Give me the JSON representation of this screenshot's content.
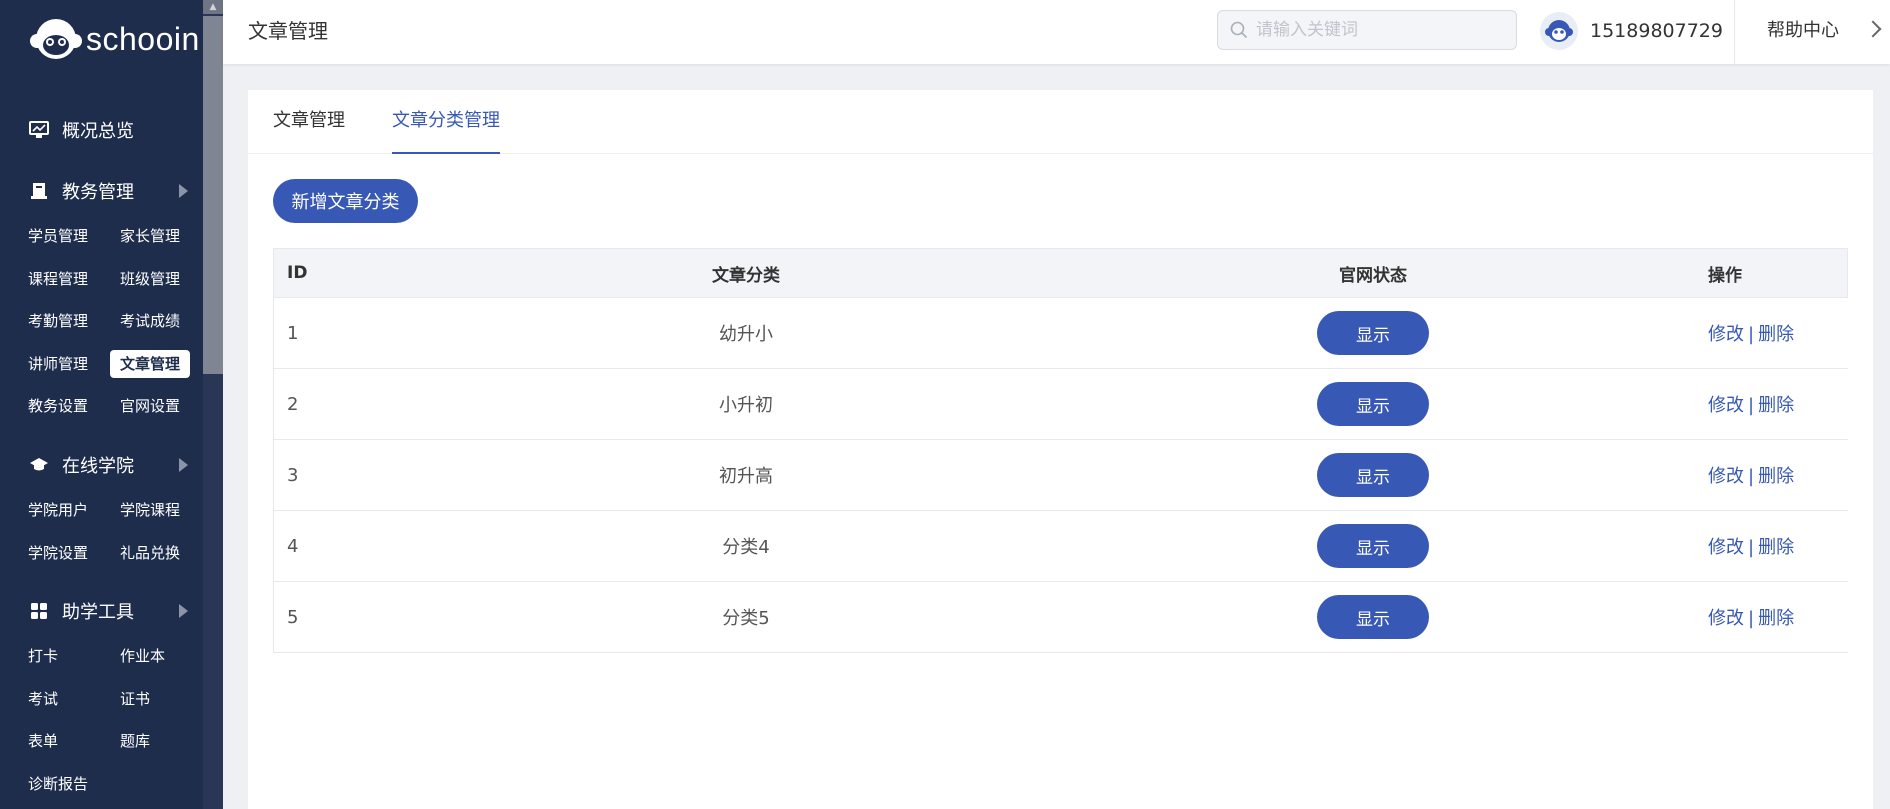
{
  "brand": {
    "name": "schooin"
  },
  "sidebar": {
    "groups": [
      {
        "label": "概况总览",
        "icon": "monitor-icon"
      },
      {
        "label": "教务管理",
        "icon": "book-icon",
        "items": [
          "学员管理",
          "家长管理",
          "课程管理",
          "班级管理",
          "考勤管理",
          "考试成绩",
          "讲师管理",
          "文章管理",
          "教务设置",
          "官网设置"
        ]
      },
      {
        "label": "在线学院",
        "icon": "graduation-cap-icon",
        "items": [
          "学院用户",
          "学院课程",
          "学院设置",
          "礼品兑换"
        ]
      },
      {
        "label": "助学工具",
        "icon": "grid-icon",
        "items": [
          "打卡",
          "作业本",
          "考试",
          "证书",
          "表单",
          "题库",
          "诊断报告"
        ]
      }
    ],
    "active_item": "文章管理"
  },
  "header": {
    "title": "文章管理",
    "search_placeholder": "请输入关键词",
    "user_phone": "15189807729",
    "help": "帮助中心"
  },
  "tabs": [
    {
      "label": "文章管理",
      "active": false
    },
    {
      "label": "文章分类管理",
      "active": true
    }
  ],
  "add_button": "新增文章分类",
  "table": {
    "columns": [
      "ID",
      "文章分类",
      "官网状态",
      "操作"
    ],
    "rows": [
      {
        "id": "1",
        "category": "幼升小",
        "status": "显示"
      },
      {
        "id": "2",
        "category": "小升初",
        "status": "显示"
      },
      {
        "id": "3",
        "category": "初升高",
        "status": "显示"
      },
      {
        "id": "4",
        "category": "分类4",
        "status": "显示"
      },
      {
        "id": "5",
        "category": "分类5",
        "status": "显示"
      }
    ],
    "edit_label": "修改",
    "delete_label": "删除",
    "separator": "|"
  },
  "colors": {
    "sidebar": "#1f2d4d",
    "accent": "#3758b4"
  }
}
